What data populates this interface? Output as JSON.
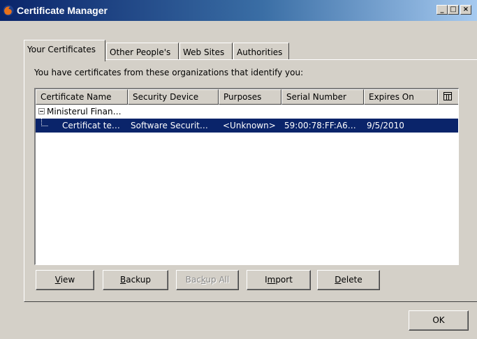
{
  "window": {
    "title": "Certificate Manager",
    "controls": [
      "_",
      "□",
      "×"
    ]
  },
  "tabs": [
    {
      "label": "Your Certificates",
      "active": true
    },
    {
      "label": "Other People's",
      "active": false
    },
    {
      "label": "Web Sites",
      "active": false
    },
    {
      "label": "Authorities",
      "active": false
    }
  ],
  "panel": {
    "intro": "You have certificates from these organizations that identify you:"
  },
  "tree": {
    "columns": [
      "Certificate Name",
      "Security Device",
      "Purposes",
      "Serial Number",
      "Expires On"
    ],
    "group": {
      "label": "Ministerul Finan…",
      "expanded": true
    },
    "rows": [
      {
        "name": "Certificat te…",
        "device": "Software Securit…",
        "purposes": "<Unknown>",
        "serial": "59:00:78:FF:A6…",
        "expires": "9/5/2010",
        "selected": true
      }
    ]
  },
  "buttons": {
    "view": {
      "label": "View",
      "mnemonic": "V"
    },
    "backup": {
      "label": "Backup",
      "mnemonic": "B"
    },
    "backup_all": {
      "label": "Backup All",
      "mnemonic": "k",
      "disabled": true
    },
    "import": {
      "label": "Import",
      "mnemonic": "m"
    },
    "delete": {
      "label": "Delete",
      "mnemonic": "D"
    }
  },
  "ok_label": "OK",
  "colors": {
    "selection": "#0a246a",
    "face": "#d4d0c8"
  }
}
